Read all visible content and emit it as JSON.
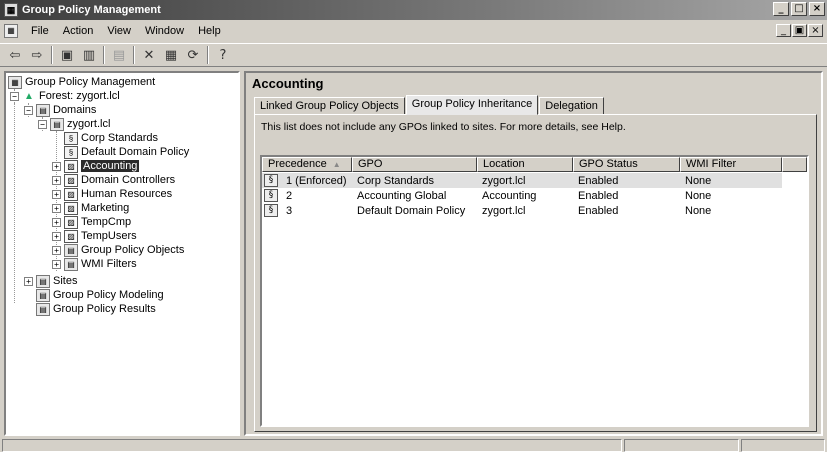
{
  "window": {
    "title": "Group Policy Management",
    "controls": [
      "_",
      "□",
      "×"
    ],
    "child_controls": [
      "_",
      "▣",
      "×"
    ]
  },
  "menu": {
    "items": [
      {
        "label": "File"
      },
      {
        "label": "Action"
      },
      {
        "label": "View"
      },
      {
        "label": "Window"
      },
      {
        "label": "Help"
      }
    ]
  },
  "toolbar": {
    "buttons": [
      {
        "icon": "back-arrow-icon",
        "glyph": "⇦"
      },
      {
        "icon": "forward-arrow-icon",
        "glyph": "⇨"
      },
      {
        "icon": "up-folder-icon",
        "glyph": "▣"
      },
      {
        "icon": "show-hide-tree-icon",
        "glyph": "▥"
      },
      {
        "icon": "paste-icon",
        "glyph": "▤"
      },
      {
        "icon": "delete-icon",
        "glyph": "✕"
      },
      {
        "icon": "properties-icon",
        "glyph": "▦"
      },
      {
        "icon": "refresh-icon",
        "glyph": "⟳"
      },
      {
        "icon": "help-icon",
        "glyph": "?"
      }
    ]
  },
  "tree": {
    "root": "Group Policy Management",
    "forest": "Forest: zygort.lcl",
    "domains": "Domains",
    "domain": "zygort.lcl",
    "corp_standards": "Corp Standards",
    "default_domain_policy": "Default Domain Policy",
    "accounting": "Accounting",
    "domain_controllers": "Domain Controllers",
    "human_resources": "Human Resources",
    "marketing": "Marketing",
    "tempcmp": "TempCmp",
    "tempusers": "TempUsers",
    "gpo_objects": "Group Policy Objects",
    "wmi_filters": "WMI Filters",
    "sites": "Sites",
    "modeling": "Group Policy Modeling",
    "results": "Group Policy Results"
  },
  "details": {
    "title": "Accounting",
    "tabs": [
      {
        "label": "Linked Group Policy Objects"
      },
      {
        "label": "Group Policy Inheritance"
      },
      {
        "label": "Delegation"
      }
    ],
    "info": "This list does not include any GPOs linked to sites. For more details, see Help.",
    "columns": [
      "Precedence",
      "GPO",
      "Location",
      "GPO Status",
      "WMI Filter"
    ],
    "rows": [
      {
        "precedence": "1 (Enforced)",
        "gpo": "Corp Standards",
        "location": "zygort.lcl",
        "status": "Enabled",
        "wmi": "None"
      },
      {
        "precedence": "2",
        "gpo": "Accounting Global",
        "location": "Accounting",
        "status": "Enabled",
        "wmi": "None"
      },
      {
        "precedence": "3",
        "gpo": "Default Domain Policy",
        "location": "zygort.lcl",
        "status": "Enabled",
        "wmi": "None"
      }
    ]
  },
  "colors": {
    "selection": "#2b2b2b",
    "row_highlight": "#e0e0e0",
    "chrome": "#d4d0c8"
  }
}
